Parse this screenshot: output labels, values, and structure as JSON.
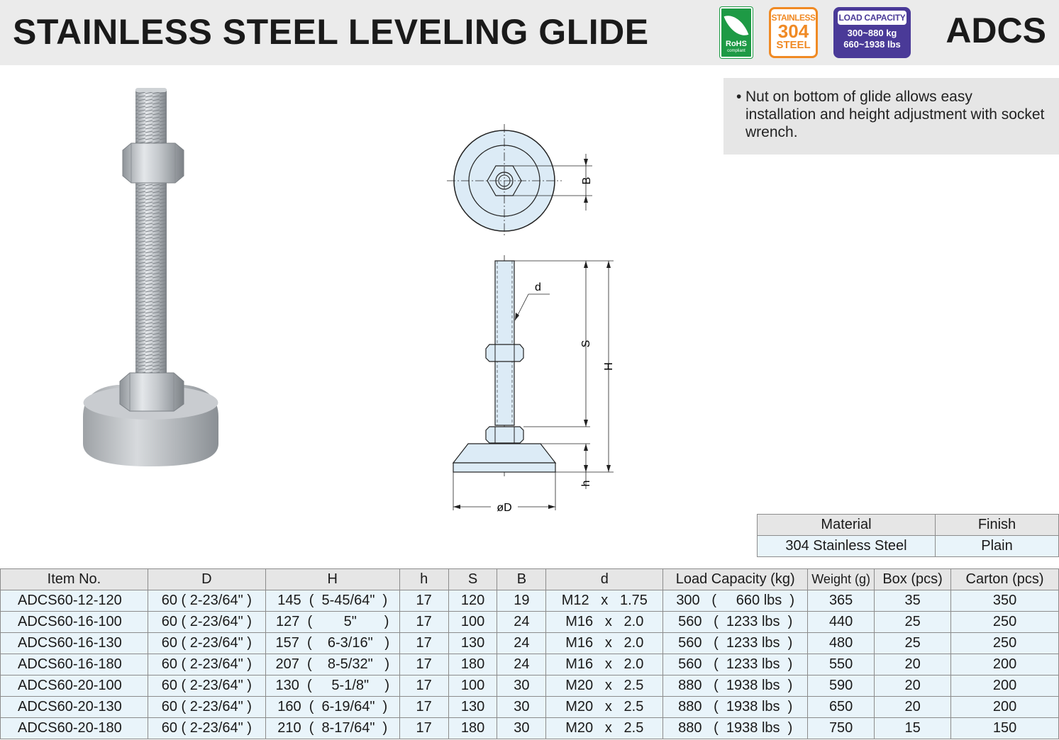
{
  "header": {
    "title": "STAINLESS STEEL LEVELING GLIDE",
    "code": "ADCS",
    "badges": {
      "rohs": {
        "label": "RoHS",
        "sub": "compliant",
        "color": "#1e9a45"
      },
      "steel": {
        "line1": "STAINLESS",
        "line2": "304",
        "line3": "STEEL",
        "color": "#f08a24"
      },
      "load": {
        "label": "LOAD CAPACITY",
        "line1": "300~880 kg",
        "line2": "660~1938 lbs",
        "color": "#4a3a98"
      }
    }
  },
  "note": {
    "bullet": "•",
    "text": "Nut on bottom of glide allows easy installation and height adjustment with socket wrench."
  },
  "drawing": {
    "labels": {
      "B": "B",
      "d": "d",
      "S": "S",
      "H": "H",
      "h": "h",
      "D": "øD"
    }
  },
  "material_table": {
    "headers": [
      "Material",
      "Finish"
    ],
    "row": [
      "304 Stainless Steel",
      "Plain"
    ]
  },
  "spec_table": {
    "headers": [
      "Item No.",
      "D",
      "H",
      "h",
      "S",
      "B",
      "d",
      "Load Capacity (kg)",
      "Weight (g)",
      "Box (pcs)",
      "Carton (pcs)"
    ],
    "rows": [
      [
        "ADCS60-12-120",
        "60 ( 2-23/64\" )",
        "145  (  5-45/64\"  )",
        "17",
        "120",
        "19",
        "M12   x   1.75",
        "300   (     660 lbs  )",
        "365",
        "35",
        "350"
      ],
      [
        "ADCS60-16-100",
        "60 ( 2-23/64\" )",
        "127  (        5\"       )",
        "17",
        "100",
        "24",
        "M16   x   2.0",
        "560   (  1233 lbs  )",
        "440",
        "25",
        "250"
      ],
      [
        "ADCS60-16-130",
        "60 ( 2-23/64\" )",
        "157  (    6-3/16\"   )",
        "17",
        "130",
        "24",
        "M16   x   2.0",
        "560   (  1233 lbs  )",
        "480",
        "25",
        "250"
      ],
      [
        "ADCS60-16-180",
        "60 ( 2-23/64\" )",
        "207  (    8-5/32\"   )",
        "17",
        "180",
        "24",
        "M16   x   2.0",
        "560   (  1233 lbs  )",
        "550",
        "20",
        "200"
      ],
      [
        "ADCS60-20-100",
        "60 ( 2-23/64\" )",
        "130  (     5-1/8\"    )",
        "17",
        "100",
        "30",
        "M20   x   2.5",
        "880   (  1938 lbs  )",
        "590",
        "20",
        "200"
      ],
      [
        "ADCS60-20-130",
        "60 ( 2-23/64\" )",
        "160  (  6-19/64\"  )",
        "17",
        "130",
        "30",
        "M20   x   2.5",
        "880   (  1938 lbs  )",
        "650",
        "20",
        "200"
      ],
      [
        "ADCS60-20-180",
        "60 ( 2-23/64\" )",
        "210  (  8-17/64\"  )",
        "17",
        "180",
        "30",
        "M20   x   2.5",
        "880   (  1938 lbs  )",
        "750",
        "15",
        "150"
      ]
    ]
  }
}
